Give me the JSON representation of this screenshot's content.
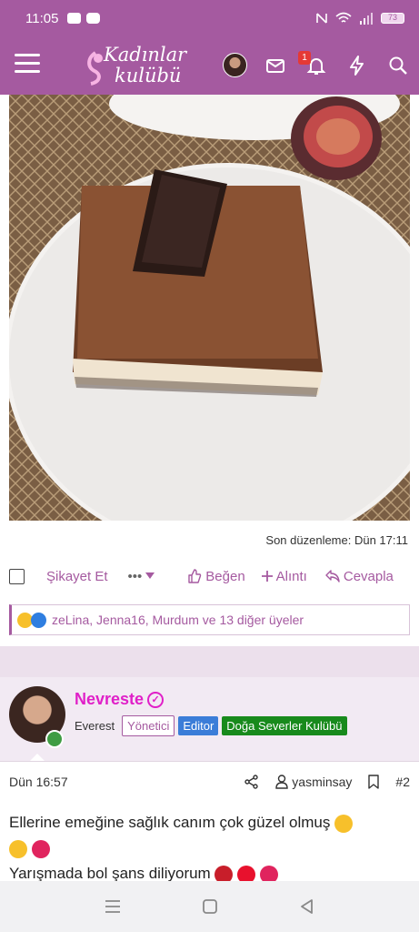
{
  "status_bar": {
    "time": "11:05",
    "battery": "73"
  },
  "header": {
    "logo_line1": "Kadınlar",
    "logo_line2": "kulübü",
    "notification_count": "1"
  },
  "post": {
    "edit_note": "Son düzenleme: Dün 17:11",
    "actions": {
      "report": "Şikayet Et",
      "more": "•••",
      "like": "Beğen",
      "quote": "Alıntı",
      "reply": "Cevapla"
    },
    "reactions_text": "zeLina, Jenna16, Murdum ve 13 diğer üyeler"
  },
  "reply_post": {
    "username": "Nevreste",
    "title_plain": "Everest",
    "tags": {
      "yonetici": "Yönetici",
      "editor": "Editor",
      "doga": "Doğa Severler Kulübü"
    },
    "time": "Dün 16:57",
    "author_link": "yasminsay",
    "post_number": "#2",
    "line1": "Ellerine emeğine sağlık canım çok güzel olmuş",
    "line2": "Yarışmada bol şans diliyorum"
  },
  "colors": {
    "brand": "#a55aa0",
    "username": "#e020c8",
    "editor_tag": "#3b7dd8",
    "doga_tag": "#188a1c"
  },
  "icons": [
    "menu-icon",
    "mail-icon",
    "bell-icon",
    "lightning-icon",
    "search-icon",
    "checkbox-icon",
    "like-icon",
    "plus-icon",
    "reply-icon",
    "share-icon",
    "user-icon",
    "bookmark-icon",
    "verified-icon"
  ]
}
